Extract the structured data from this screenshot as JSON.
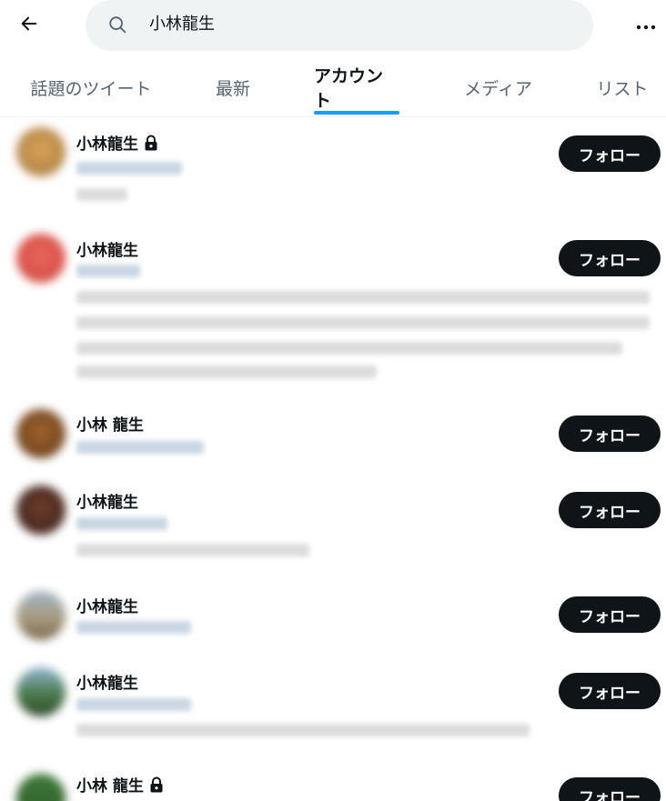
{
  "search": {
    "query": "小林龍生"
  },
  "icons": {
    "back": "arrow-left-icon",
    "search": "search-icon",
    "more": "more-horizontal-icon",
    "lock": "lock-icon"
  },
  "colors": {
    "accent": "#1d9bf0",
    "follow_button": "#0f1419",
    "search_bg": "#eff3f4"
  },
  "tabs": [
    {
      "label": "話題のツイート",
      "active": false
    },
    {
      "label": "最新",
      "active": false
    },
    {
      "label": "アカウント",
      "active": true
    },
    {
      "label": "メディア",
      "active": false
    },
    {
      "label": "リスト",
      "active": false
    }
  ],
  "results": [
    {
      "name": "小林龍生",
      "locked": true,
      "follow_label": "フォロー"
    },
    {
      "name": "小林龍生",
      "locked": false,
      "follow_label": "フォロー"
    },
    {
      "name": "小林 龍生",
      "locked": false,
      "follow_label": "フォロー"
    },
    {
      "name": "小林龍生",
      "locked": false,
      "follow_label": "フォロー"
    },
    {
      "name": "小林龍生",
      "locked": false,
      "follow_label": "フォロー"
    },
    {
      "name": "小林龍生",
      "locked": false,
      "follow_label": "フォロー"
    },
    {
      "name": "小林 龍生",
      "locked": true,
      "follow_label": "フォロー"
    }
  ]
}
